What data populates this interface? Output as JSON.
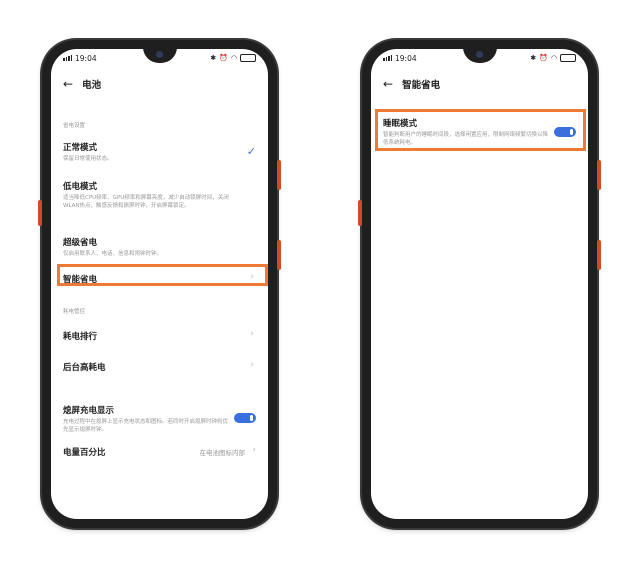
{
  "status": {
    "time": "19:04"
  },
  "left": {
    "title": "电池",
    "section_power": "省电设置",
    "items": [
      {
        "title": "正常模式",
        "desc": "保留日常使用状态。"
      },
      {
        "title": "低电模式",
        "desc": "适当降低CPU频率、GPU频率和屏幕亮度，减少自动锁屏时间，关闭WLAN热点，触感反馈和振屏时钟，开启屏幕锁定。"
      },
      {
        "title": "超级省电",
        "desc": "仅启用联系人、电话、信息和闹钟时钟。"
      },
      {
        "title": "智能省电"
      }
    ],
    "section_usage": "耗电管控",
    "usage_items": [
      {
        "title": "耗电排行"
      },
      {
        "title": "后台高耗电"
      }
    ],
    "screen_off": {
      "title": "熄屏充电显示",
      "desc": "充电过程中在熄屏上显示充电状态和图标。若同时开启熄屏时钟则优先显示熄屏时钟。",
      "enabled": true
    },
    "percent": {
      "title": "电量百分比",
      "value": "在电池图标内部"
    }
  },
  "right": {
    "title": "智能省电",
    "sleep": {
      "title": "睡眠模式",
      "desc": "智能判断用户的睡眠时间段，选择闲置应用，限制网络频繁切换以降低系统耗电。",
      "enabled": true
    }
  },
  "colors": {
    "accent": "#3a6fe0",
    "highlight": "#ee7a33"
  }
}
